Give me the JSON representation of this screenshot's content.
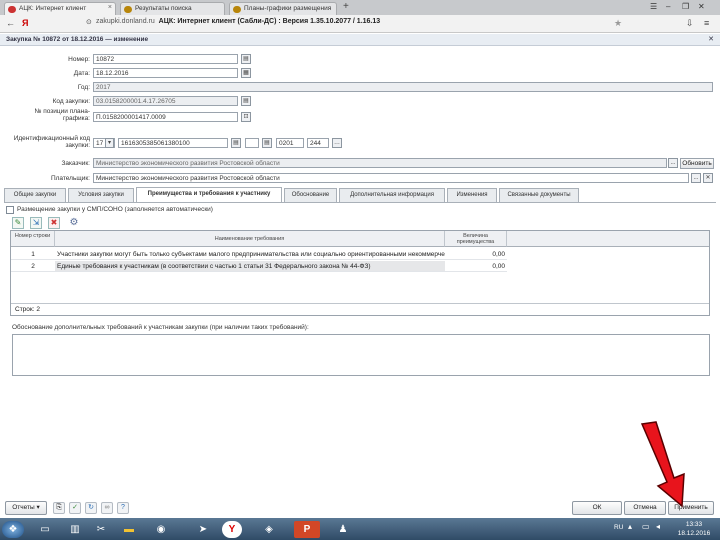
{
  "browser": {
    "tabs": [
      {
        "title": "АЦК: Интернет клиент",
        "active": true
      },
      {
        "title": "Результаты поиска",
        "active": false
      },
      {
        "title": "Планы-графики размещения",
        "active": false
      }
    ],
    "new_tab": "+",
    "back": "←",
    "brand": "Я",
    "url_domain": "zakupki.donland.ru",
    "url_title": "АЦК: Интернет клиент (Сабли-ДС) : Версия 1.35.10.2077 / 1.16.13"
  },
  "app": {
    "title": "Закупка № 10872 от 18.12.2016 — изменение"
  },
  "form": {
    "number_label": "Номер:",
    "number_value": "10872",
    "date_label": "Дата:",
    "date_value": "18.12.2016",
    "year_label": "Год:",
    "year_value": "2017",
    "code_label": "Код закупки:",
    "code_value": "03.0158200001.4.17.26705",
    "position_label": "№ позиции плана-графика:",
    "position_value": "П.0158200001417.0009",
    "ikz_label": "Идентификационный код закупки:",
    "ikz_year": "17",
    "ikz_main": "1616305385061380100",
    "ikz_num1": "0201",
    "ikz_num2": "244",
    "customer_label": "Заказчик:",
    "customer_value": "Министерство экономического развития Ростовской области",
    "customer_button": "Обновить",
    "place_label": "Плательщик:",
    "place_value": "Министерство экономического развития Ростовской области",
    "ellipsis": "..."
  },
  "tabs": [
    "Общие закупки",
    "Условия закупки",
    "Преимущества и требования к участнику",
    "Обоснование",
    "Дополнительная информация",
    "Изменения",
    "Связанные документы"
  ],
  "active_tab_index": 2,
  "section": {
    "checkbox_label": "Размещение закупки у СМП/СОНО (заполняется автоматически)"
  },
  "grid": {
    "columns": [
      "Номер строки",
      "Наименование требования",
      "Величина преимущества"
    ],
    "rows": [
      {
        "num": "1",
        "name": "Участники закупки могут быть только субъектами малого предпринимательства или социально ориентированными некоммерческими организациями",
        "value": "0,00"
      },
      {
        "num": "2",
        "name": "Единые требования к участникам (в соответствии с частью 1 статьи 31 Федерального закона № 44-ФЗ)",
        "value": "0,00"
      }
    ],
    "rows_count_label": "Строк: 2"
  },
  "reason": {
    "label": "Обоснование дополнительных требований к участникам закупки (при наличии таких требований):"
  },
  "footer": {
    "print_label": "Отчеты",
    "ok_label": "ОК",
    "cancel_label": "Отмена",
    "apply_label": "Применить"
  },
  "taskbar": {
    "lang": "RU",
    "time": "13:33",
    "date": "18.12.2016"
  },
  "colors": {
    "arrow": "#e8141c",
    "taskbar": "#3d5a76"
  }
}
